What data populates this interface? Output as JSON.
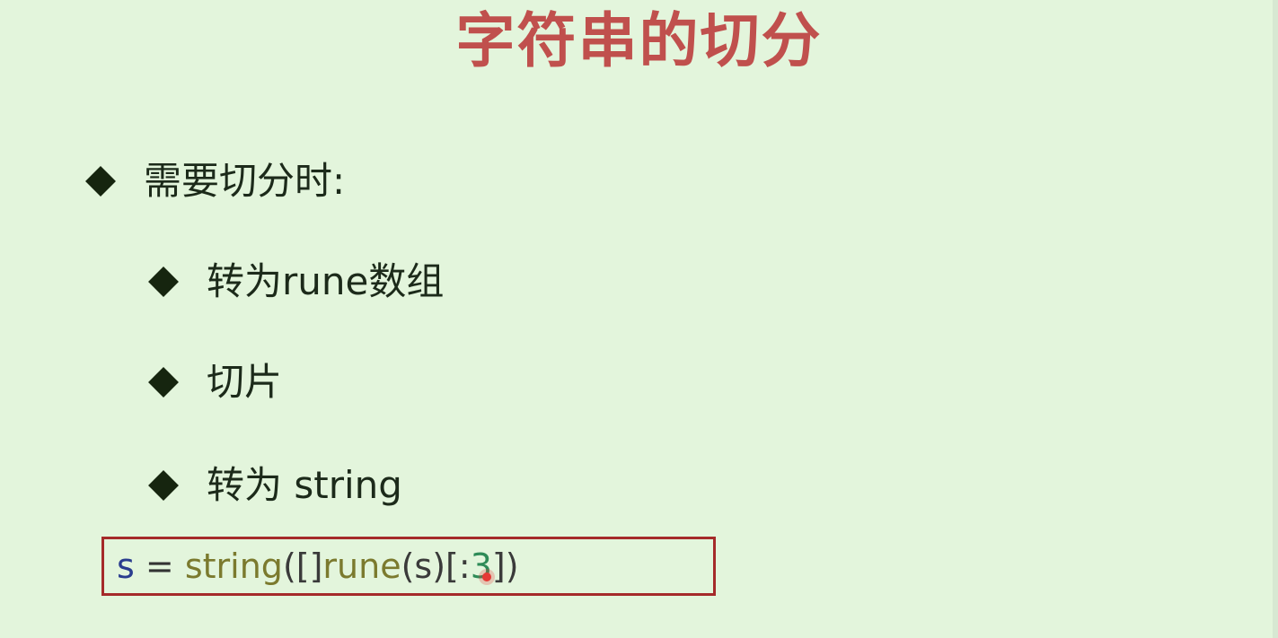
{
  "slide": {
    "title": "字符串的切分",
    "bullets": [
      {
        "text": "需要切分时:"
      },
      {
        "text": "转为rune数组"
      },
      {
        "text": "切片"
      },
      {
        "text": "转为 string"
      }
    ],
    "code": {
      "var": "s",
      "space1": " ",
      "op": "=",
      "space2": " ",
      "fn": "string",
      "open_paren": "(",
      "slice_type": "[]",
      "fn2": "rune",
      "arg": "(s)",
      "slice_open": "[:",
      "num": "3",
      "slice_close": "]",
      "close_paren": ")"
    }
  },
  "colors": {
    "background": "#e3f5dc",
    "title": "#c0504d",
    "code_border": "#a52a2a"
  }
}
